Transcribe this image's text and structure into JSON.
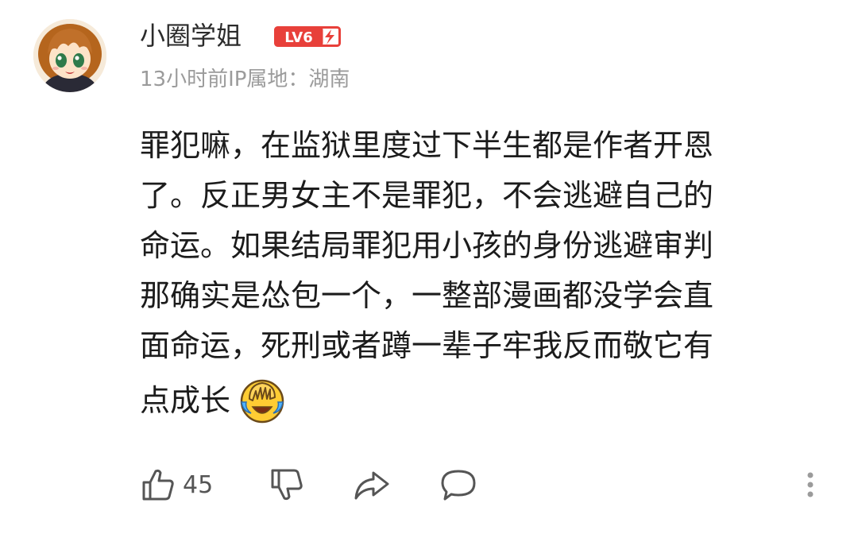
{
  "comment": {
    "user": {
      "name": "小圈学姐",
      "level": "LV6",
      "avatar_icon": "anime-girl-avatar"
    },
    "meta": "13小时前IP属地：湖南",
    "content_lines": [
      "罪犯嘛，在监狱里度过下半生都是作者开恩",
      "了。反正男女主不是罪犯，不会逃避自己的",
      "命运。如果结局罪犯用小孩的身份逃避审判",
      "那确实是怂包一个，一整部漫画都没学会直",
      "面命运，死刑或者蹲一辈子牢我反而敬它有",
      "点成长"
    ],
    "emoji_icon": "facepalm-laugh-emoji",
    "actions": {
      "like_count": "45",
      "like_icon": "thumbs-up-icon",
      "dislike_icon": "thumbs-down-icon",
      "share_icon": "share-icon",
      "reply_icon": "comment-icon",
      "more_icon": "more-vertical-icon"
    }
  },
  "colors": {
    "badge_red": "#e8403a",
    "text_dark": "#1c1c1c",
    "meta_gray": "#9b9b9b",
    "icon_gray": "#555555"
  }
}
